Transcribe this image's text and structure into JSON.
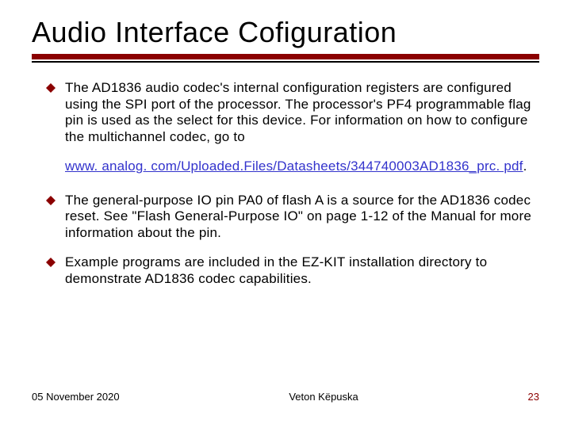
{
  "title": "Audio Interface Cofiguration",
  "bullets": {
    "b1": "The AD1836 audio codec's internal configuration registers are configured using the SPI port of the processor. The processor's PF4 programmable flag pin is used as the select for this device. For information on how to configure the multichannel codec, go to",
    "link": "www. analog. com/Uploaded.Files/Datasheets/344740003AD1836_prc. pdf",
    "b2": "The general-purpose IO pin PA0 of flash A is a source for the AD1836 codec reset. See \"Flash General-Purpose IO\" on page 1-12 of the Manual for more information about the pin.",
    "b3": "Example programs are included in the EZ-KIT installation directory to demonstrate AD1836 codec capabilities."
  },
  "footer": {
    "date": "05 November 2020",
    "author": "Veton Këpuska",
    "page": "23"
  }
}
